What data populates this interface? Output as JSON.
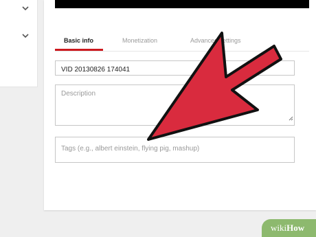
{
  "nav": {
    "expand_icons": [
      "chevron-down-icon",
      "chevron-down-icon"
    ]
  },
  "tabs": [
    {
      "label": "Basic info",
      "active": true
    },
    {
      "label": "Monetization",
      "active": false
    },
    {
      "label": "Advanced settings",
      "active": false
    }
  ],
  "form": {
    "title_value": "VID 20130826 174041",
    "description_placeholder": "Description",
    "tags_placeholder": "Tags (e.g., albert einstein, flying pig, mashup)"
  },
  "overlay": {
    "arrow_color": "#d92b3e"
  },
  "watermark": {
    "prefix": "wiki",
    "suffix": "How"
  },
  "colors": {
    "accent": "#cc181e",
    "watermark_bg": "#8db96e"
  }
}
